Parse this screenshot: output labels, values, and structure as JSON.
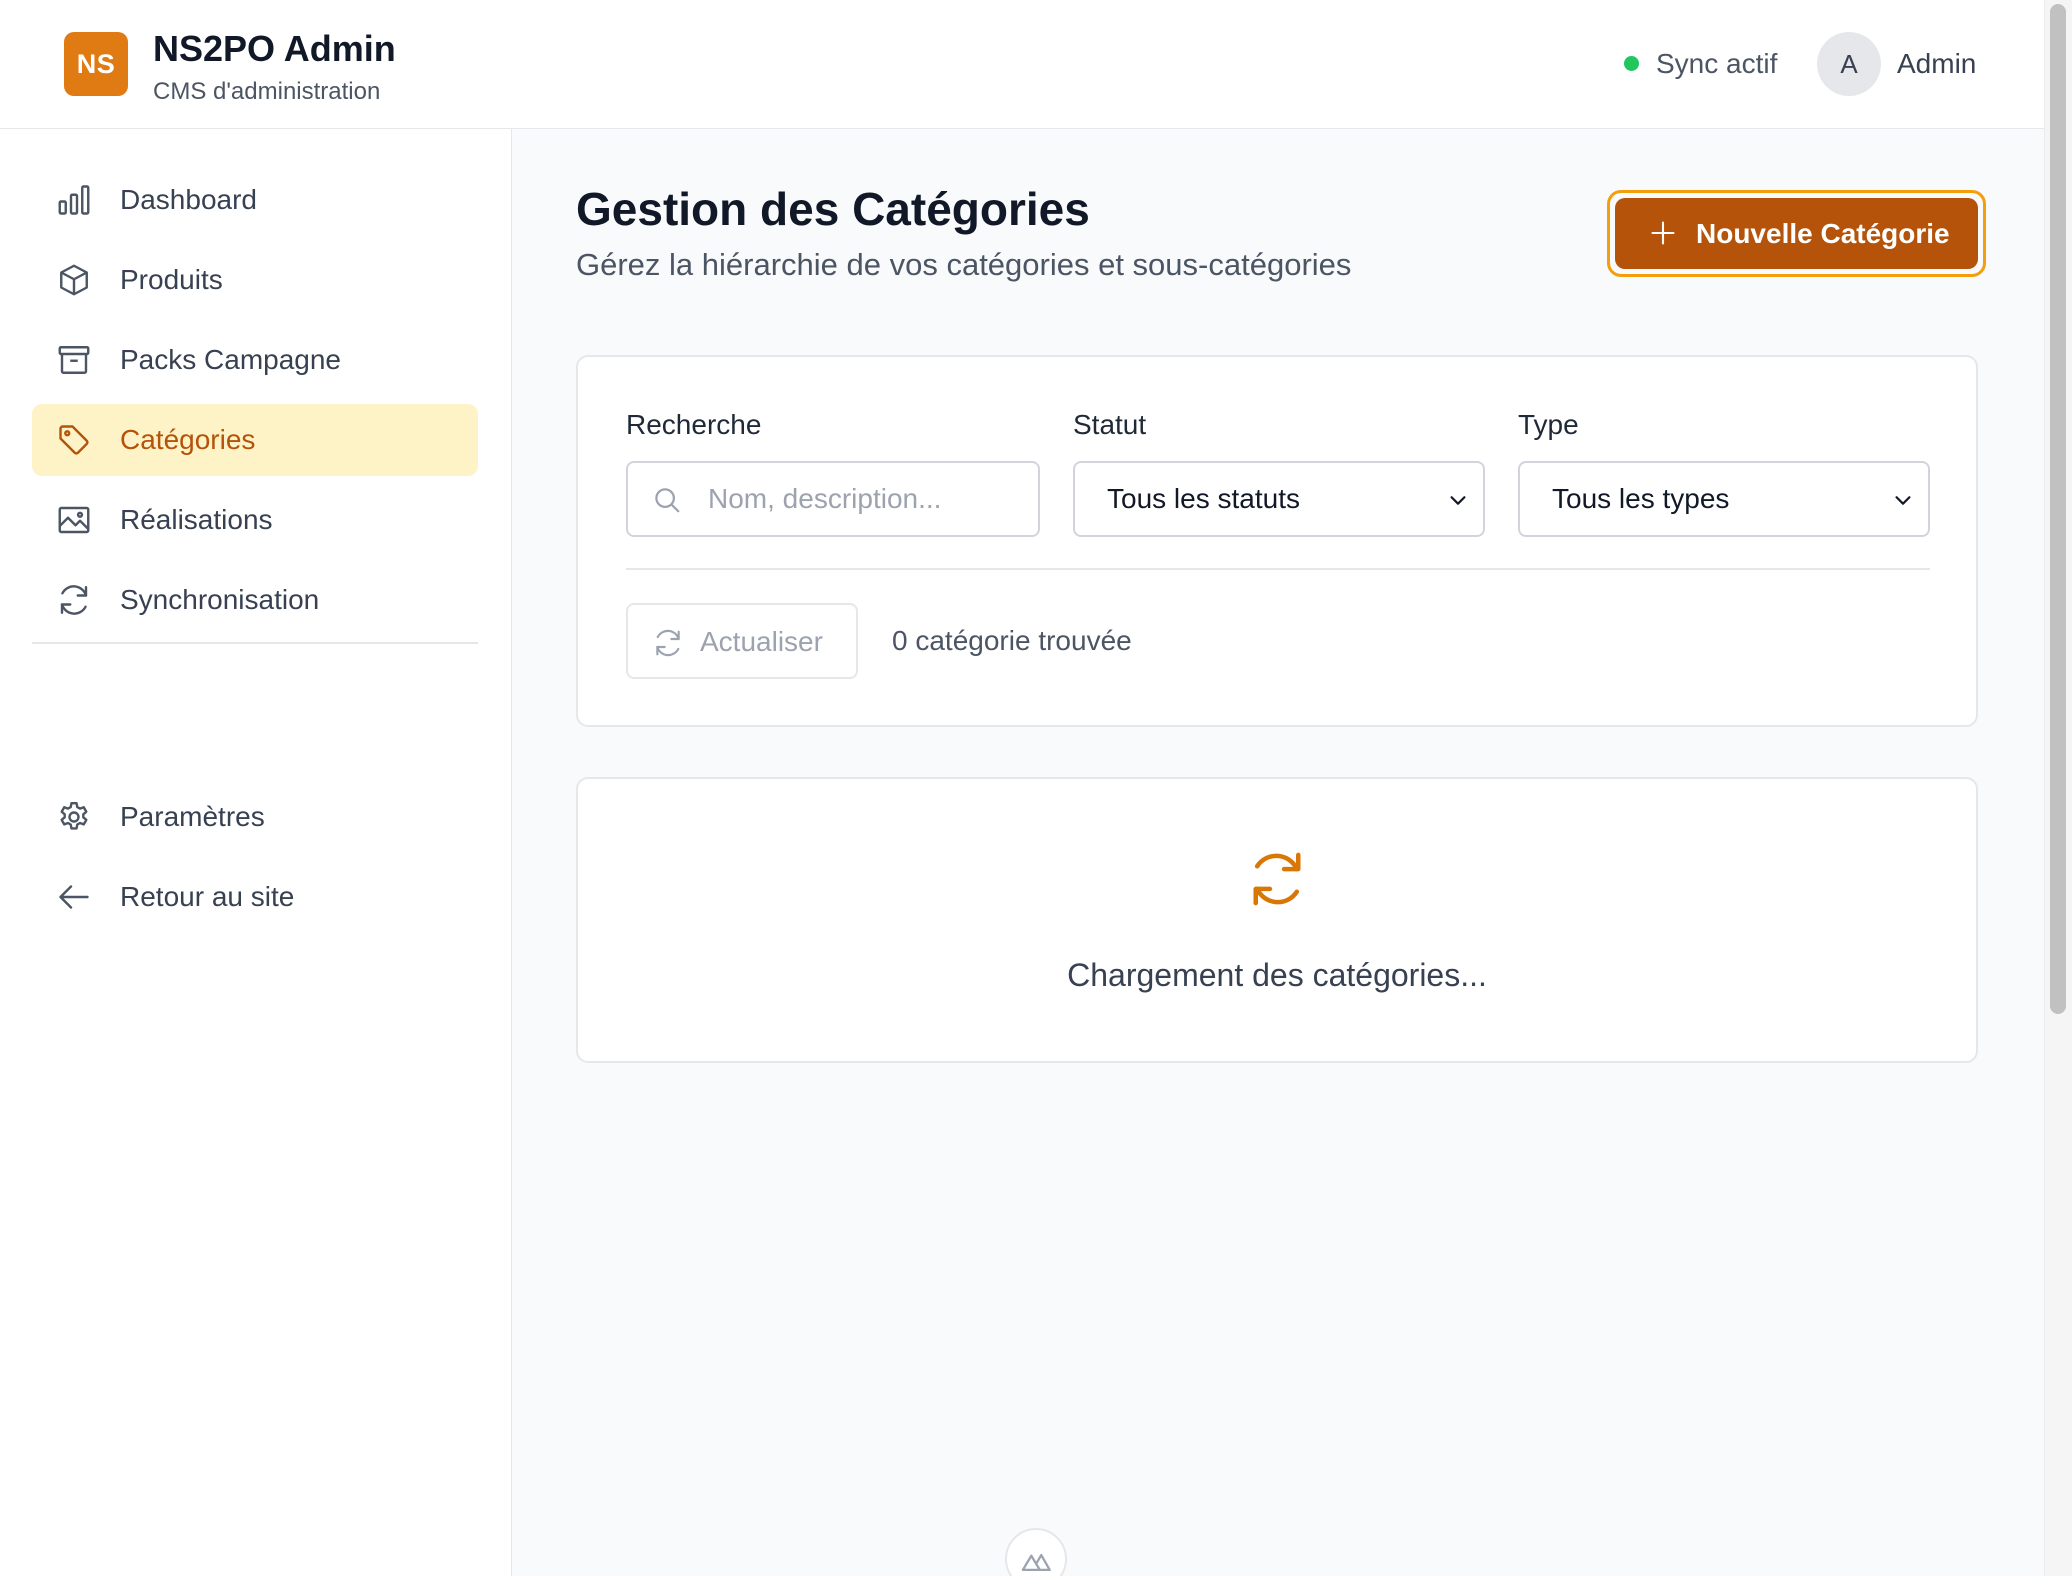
{
  "header": {
    "logo_text": "NS",
    "title": "NS2PO Admin",
    "subtitle": "CMS d'administration",
    "sync_status": "Sync actif",
    "avatar_initial": "A",
    "user_name": "Admin"
  },
  "sidebar": {
    "items": [
      {
        "label": "Dashboard",
        "icon": "bar-chart-icon",
        "active": false
      },
      {
        "label": "Produits",
        "icon": "cube-icon",
        "active": false
      },
      {
        "label": "Packs Campagne",
        "icon": "archive-box-icon",
        "active": false
      },
      {
        "label": "Catégories",
        "icon": "tag-icon",
        "active": true
      },
      {
        "label": "Réalisations",
        "icon": "image-icon",
        "active": false
      },
      {
        "label": "Synchronisation",
        "icon": "sync-icon",
        "active": false
      }
    ],
    "footer_items": [
      {
        "label": "Paramètres",
        "icon": "gear-icon"
      },
      {
        "label": "Retour au site",
        "icon": "arrow-left-icon"
      }
    ]
  },
  "main": {
    "title": "Gestion des Catégories",
    "subtitle": "Gérez la hiérarchie de vos catégories et sous-catégories",
    "new_button_label": "Nouvelle Catégorie",
    "filters": {
      "search_label": "Recherche",
      "search_placeholder": "Nom, description...",
      "status_label": "Statut",
      "status_value": "Tous les statuts",
      "type_label": "Type",
      "type_value": "Tous les types"
    },
    "refresh_label": "Actualiser",
    "result_count": "0 catégorie trouvée",
    "loading_text": "Chargement des catégories..."
  },
  "colors": {
    "accent": "#b45309",
    "accent_light": "#fef3c7",
    "logo": "#e07a12",
    "sync_dot": "#22c55e"
  }
}
